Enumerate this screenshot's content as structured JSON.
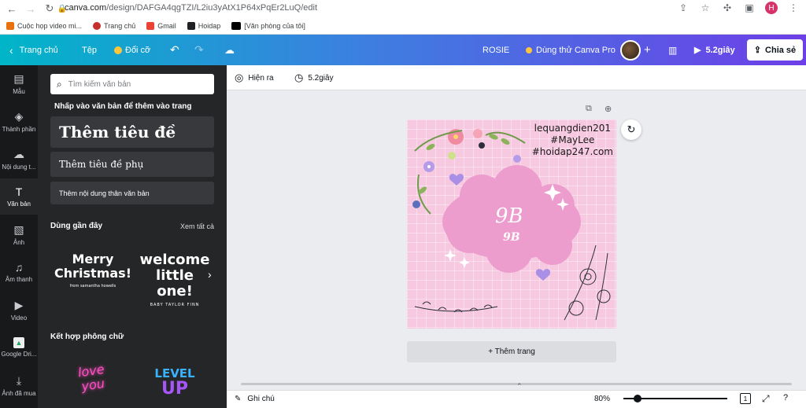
{
  "browser": {
    "url_host": "canva.com",
    "url_path": "/design/DAFGA4qgTZI/L2iu3yAtX1P64xPqEr2LuQ/edit",
    "avatar_letter": "H",
    "bookmarks": [
      {
        "label": "Cuộc họp video mi...",
        "color": "#e8710a"
      },
      {
        "label": "Trang chủ",
        "color": "#c4302b"
      },
      {
        "label": "Gmail",
        "color": "#ea4335"
      },
      {
        "label": "Hoidap",
        "color": "#202124"
      },
      {
        "label": "[Văn phòng của tôi]",
        "color": "#3c4043"
      }
    ]
  },
  "topbar": {
    "home": "Trang chủ",
    "file": "Tệp",
    "resize": "Đổi cỡ",
    "title": "ROSIE",
    "try_pro": "Dùng thử Canva Pro",
    "present": "5.2giây",
    "share": "Chia sẻ"
  },
  "rail": [
    {
      "label": "Mẫu",
      "icon": "template-icon"
    },
    {
      "label": "Thành phần",
      "icon": "elements-icon"
    },
    {
      "label": "Nội dung t...",
      "icon": "upload-icon"
    },
    {
      "label": "Văn bản",
      "icon": "text-icon",
      "active": true
    },
    {
      "label": "Ảnh",
      "icon": "photo-icon"
    },
    {
      "label": "Âm thanh",
      "icon": "audio-icon"
    },
    {
      "label": "Video",
      "icon": "video-icon"
    },
    {
      "label": "Google Dri...",
      "icon": "google-drive-icon"
    },
    {
      "label": "Ảnh đã mua",
      "icon": "download-icon"
    }
  ],
  "panel": {
    "search_placeholder": "Tìm kiếm văn bản",
    "hint": "Nhấp vào văn bản để thêm vào trang",
    "heading": "Thêm tiêu đề",
    "subheading": "Thêm tiêu đề phụ",
    "body": "Thêm nội dung thân văn bản",
    "recent_title": "Dùng gần đây",
    "see_all": "Xem tất cả",
    "combo_title": "Kết hợp phông chữ",
    "thumbs": {
      "merry_line1": "Merry",
      "merry_line2": "Christmas!",
      "merry_sub": "from samantha howells",
      "welcome_line1": "welcome",
      "welcome_line2": "little one!",
      "welcome_sub": "BABY TAYLOR FINN",
      "love_line1": "love",
      "love_line2": "you",
      "level_line1": "LEVEL",
      "level_line2": "UP"
    }
  },
  "toolbar2": {
    "animate": "Hiện ra",
    "timing": "5.2giây"
  },
  "canvas": {
    "text_line1": "lequangdien201",
    "text_line2": "#MayLee",
    "text_line3": "#hoidap247.com",
    "monogram": "9B",
    "monogram_small": "9B",
    "add_page": "+ Thêm trang"
  },
  "bottombar": {
    "notes": "Ghi chú",
    "zoom": "80%",
    "page_num": "1"
  }
}
